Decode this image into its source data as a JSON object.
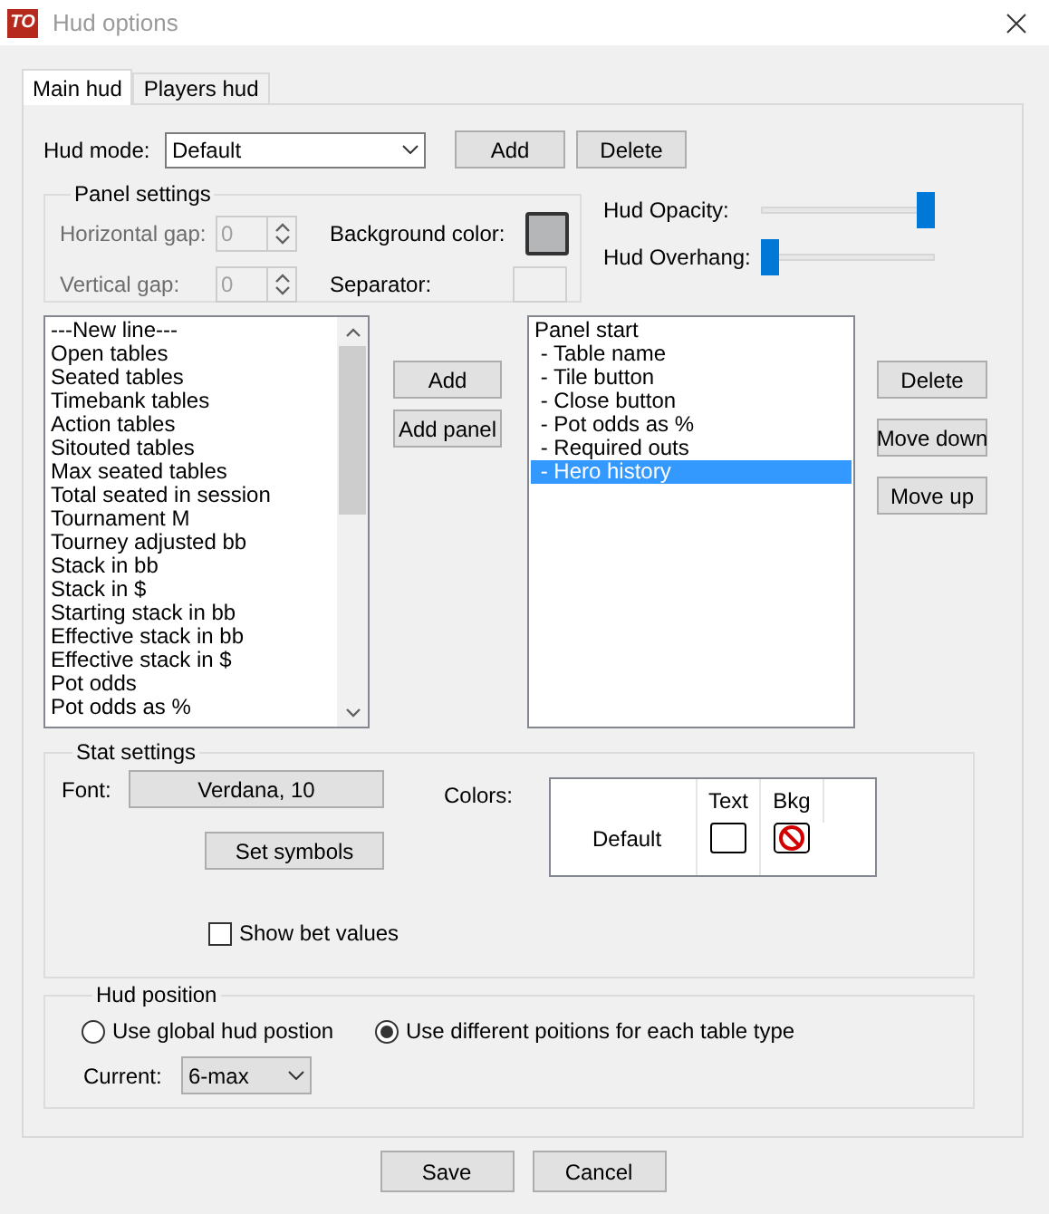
{
  "window": {
    "title": "Hud options",
    "logo": "TO"
  },
  "tabs": [
    {
      "label": "Main hud",
      "selected": true
    },
    {
      "label": "Players hud",
      "selected": false
    }
  ],
  "hud_mode": {
    "label": "Hud mode:",
    "value": "Default",
    "buttons": [
      "Add",
      "Delete"
    ]
  },
  "panel_settings": {
    "title": "Panel settings",
    "horizontal_gap": {
      "label": "Horizontal gap:",
      "value": "0",
      "disabled": true
    },
    "vertical_gap": {
      "label": "Vertical gap:",
      "value": "0",
      "disabled": true
    },
    "background_color_label": "Background color:",
    "separator_label": "Separator:"
  },
  "sliders": [
    {
      "label": "Hud Opacity:",
      "level": 1
    },
    {
      "label": "Hud Overhang:",
      "level": 0
    }
  ],
  "available_stats": [
    "---New line---",
    "Open tables",
    "Seated tables",
    "Timebank tables",
    "Action tables",
    "Sitouted tables",
    "Max seated tables",
    "Total seated in session",
    "Tournament M",
    "Tourney adjusted bb",
    "Stack in bb",
    "Stack in $",
    "Starting stack in bb",
    "Effective stack in bb",
    "Effective stack in $",
    "Pot odds",
    "Pot odds as %"
  ],
  "middle_buttons": [
    "Add",
    "Add panel"
  ],
  "panel_items": [
    {
      "label": "Panel start",
      "selected": false
    },
    {
      "label": " - Table name",
      "selected": false
    },
    {
      "label": " - Tile button",
      "selected": false
    },
    {
      "label": " - Close button",
      "selected": false
    },
    {
      "label": " - Pot odds as %",
      "selected": false
    },
    {
      "label": " - Required outs",
      "selected": false
    },
    {
      "label": " - Hero history",
      "selected": true
    }
  ],
  "side_buttons": [
    "Delete",
    "Move down",
    "Move up"
  ],
  "stat_settings": {
    "title": "Stat settings",
    "font_label": "Font:",
    "font_value": "Verdana, 10",
    "set_symbols": "Set symbols",
    "colors_label": "Colors:",
    "colors_columns": [
      "Text",
      "Bkg"
    ],
    "colors_row": "Default",
    "show_bet_values": {
      "label": "Show bet values",
      "checked": false
    }
  },
  "hud_position": {
    "title": "Hud position",
    "options": [
      {
        "label": "Use global hud postion",
        "selected": false
      },
      {
        "label": "Use different poitions for each table type",
        "selected": true
      }
    ],
    "current_label": "Current:",
    "current_value": "6-max"
  },
  "footer_buttons": [
    "Save",
    "Cancel"
  ]
}
